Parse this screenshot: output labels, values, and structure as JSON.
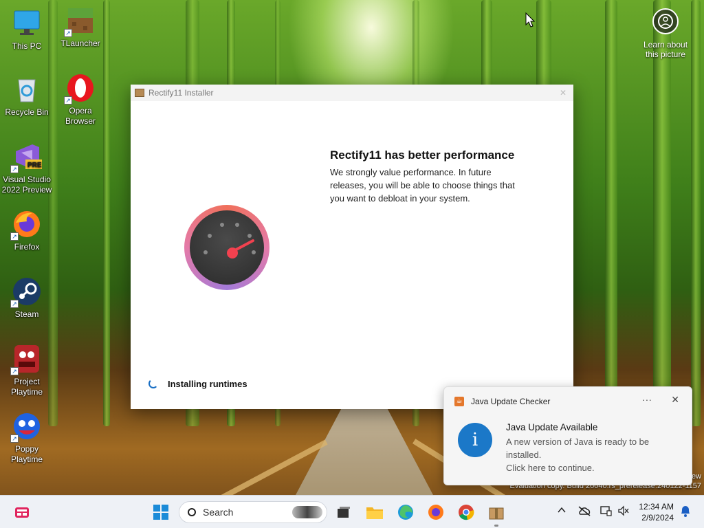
{
  "desktop": {
    "icons": [
      {
        "label": "This PC",
        "icon": "computer-icon"
      },
      {
        "label": "TLauncher",
        "icon": "minecraft-block-icon"
      },
      {
        "label": "Recycle Bin",
        "icon": "recycle-bin-icon"
      },
      {
        "label": "Opera Browser",
        "icon": "opera-icon"
      },
      {
        "label": "Visual Studio 2022 Preview",
        "icon": "visual-studio-icon",
        "badge": "PRE"
      },
      {
        "label": "Firefox",
        "icon": "firefox-icon"
      },
      {
        "label": "Steam",
        "icon": "steam-icon"
      },
      {
        "label": "Project Playtime",
        "icon": "project-playtime-icon"
      },
      {
        "label": "Poppy Playtime",
        "icon": "poppy-playtime-icon"
      }
    ],
    "learn_about": "Learn about this picture"
  },
  "installer": {
    "window_title": "Rectify11 Installer",
    "heading": "Rectify11 has better performance",
    "description": "We strongly value performance. In future releases, you will be able to choose things that you want to debloat in your system.",
    "status": "Installing runtimes"
  },
  "toast": {
    "app_name": "Java Update Checker",
    "title": "Java Update Available",
    "body": "A new version of Java is ready to be installed.\nClick here to continue.",
    "more_glyph": "···",
    "close_glyph": "✕"
  },
  "watermark": {
    "line1": "ew",
    "line2": "Evaluation copy. Build 26040.rs_prerelease.240122-1157"
  },
  "taskbar": {
    "search_placeholder": "Search",
    "time": "12:34 AM",
    "date": "2/9/2024"
  },
  "colors": {
    "accent": "#1b78c8",
    "gauge_needle": "#f2414f"
  }
}
